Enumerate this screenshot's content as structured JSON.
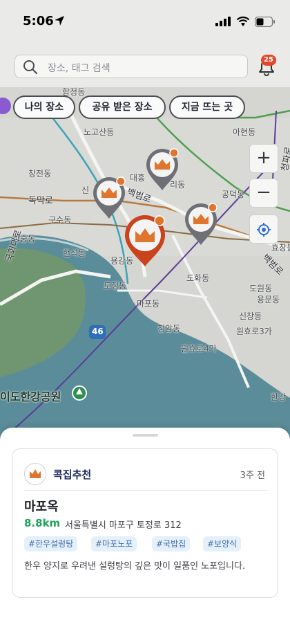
{
  "status_bar": {
    "time": "5:06"
  },
  "header": {
    "search_placeholder": "장소, 태그 검색",
    "notification_count": "25"
  },
  "filter_chips": [
    {
      "label": "나의 장소"
    },
    {
      "label": "공유 받은 장소"
    },
    {
      "label": "지금 뜨는 곳"
    }
  ],
  "map": {
    "labels": {
      "hapjeong": "합정동",
      "nogosan": "노고산동",
      "ahyeon": "아현동",
      "changjeon": "창전동",
      "daeheung": "대흥",
      "ri": "리동",
      "sin": "신",
      "gongdeok": "공덕동",
      "dongmakro": "독막로",
      "baekbeomro": "백범로",
      "gusu": "구수동",
      "hajung": "하중동",
      "hyeonseok": "현석동",
      "yonggang": "용강동",
      "dohwa": "도화동",
      "dowon": "도원동",
      "yongmun": "용문동",
      "tojeong": "토정동",
      "mapo": "마포동",
      "sinchang": "신창동",
      "cheongam": "청암동",
      "wonhyoro3": "원효로3가",
      "wonhyoro4": "원효로4가",
      "gukhoedaero": "국회대로",
      "baekbeomro2": "백범로",
      "hangang_park": "이도한강공원",
      "hangang_right": "한강",
      "road46": "46",
      "cheongpa": "청파로",
      "hyochang": "효창동"
    }
  },
  "controls": {
    "zoom_in": "+",
    "zoom_out": "−"
  },
  "place_card": {
    "brand": "콕집추천",
    "time_ago": "3주 전",
    "name": "마포옥",
    "distance": "8.8km",
    "address": "서울특별시 마포구 토정로 312",
    "tags": [
      "#한우설렁탕",
      "#마포노포",
      "#국밥집",
      "#보양식"
    ],
    "description": "한우 양지로 우려낸 설렁탕의 깊은 맛이 일품인 노포입니다."
  },
  "colors": {
    "accent_orange": "#e0762e",
    "pin_selected": "#c9431d",
    "pin_default": "#6f7075",
    "distance_green": "#1ea35a",
    "badge_red": "#e5462a",
    "tag_bg": "#e6f0fb",
    "tag_text": "#3f6fb0",
    "brand_navy": "#19275c"
  }
}
